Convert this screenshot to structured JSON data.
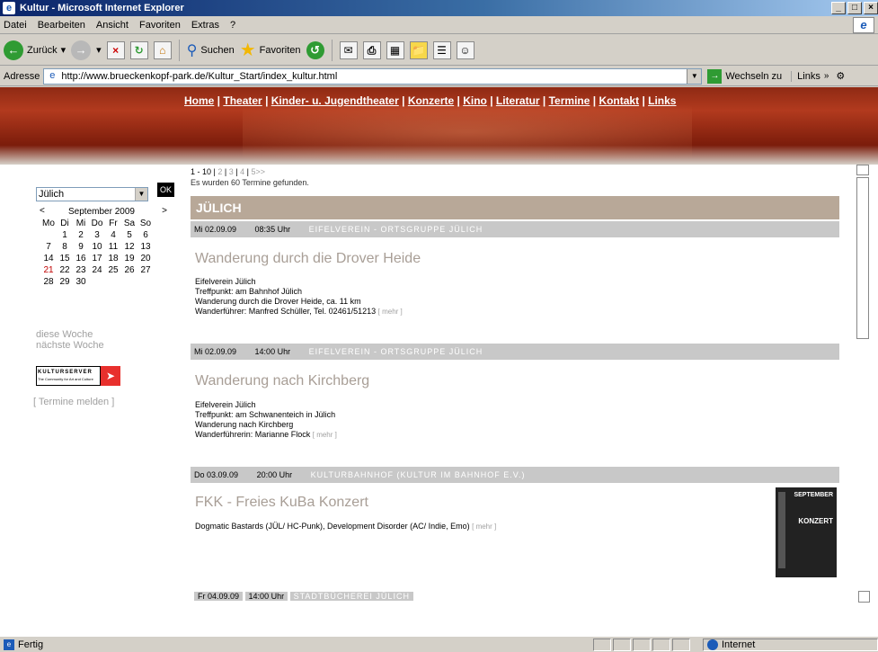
{
  "window": {
    "title": "Kultur - Microsoft Internet Explorer",
    "buttons": [
      "_",
      "□",
      "×"
    ]
  },
  "menu": [
    "Datei",
    "Bearbeiten",
    "Ansicht",
    "Favoriten",
    "Extras",
    "?"
  ],
  "toolbar": {
    "back": "Zurück",
    "search": "Suchen",
    "favorites": "Favoriten"
  },
  "address": {
    "label": "Adresse",
    "url": "http://www.brueckenkopf-park.de/Kultur_Start/index_kultur.html",
    "go": "Wechseln zu",
    "links": "Links"
  },
  "nav": {
    "items": [
      "Home",
      "Theater",
      "Kinder- u. Jugendtheater",
      "Konzerte",
      "Kino",
      "Literatur",
      "Termine",
      "Kontakt",
      "Links"
    ]
  },
  "sidebar": {
    "location": "Jülich",
    "ok": "OK",
    "calendar": {
      "month": "September 2009",
      "prev": "<",
      "next": ">",
      "weekdays": [
        "Mo",
        "Di",
        "Mi",
        "Do",
        "Fr",
        "Sa",
        "So"
      ],
      "days": [
        "",
        "1",
        "2",
        "3",
        "4",
        "5",
        "6",
        "7",
        "8",
        "9",
        "10",
        "11",
        "12",
        "13",
        "14",
        "15",
        "16",
        "17",
        "18",
        "19",
        "20",
        "21",
        "22",
        "23",
        "24",
        "25",
        "26",
        "27",
        "28",
        "29",
        "30"
      ],
      "highlight_day": "21"
    },
    "this_week": "diese Woche",
    "next_week": "nächste Woche",
    "banner_title": "KULTURSERVER",
    "banner_sub": "The Community for Art and Culture",
    "report_link": "[ Termine melden ]"
  },
  "content": {
    "pager_current": "1 - 10",
    "pager_pages": [
      "2",
      "3",
      "4",
      "5>>"
    ],
    "found": "Es wurden 60 Termine gefunden.",
    "city": "JÜLICH",
    "events": [
      {
        "date": "Mi 02.09.09",
        "time": "08:35 Uhr",
        "org": "EIFELVEREIN - ORTSGRUPPE JÜLICH",
        "title": "Wanderung durch die Drover Heide",
        "lines": [
          "Eifelverein Jülich",
          "Treffpunkt: am Bahnhof Jülich",
          "Wanderung durch die Drover Heide, ca. 11 km",
          "Wanderführer: Manfred Schüller, Tel. 02461/51213"
        ],
        "more": "[ mehr ]"
      },
      {
        "date": "Mi 02.09.09",
        "time": "14:00 Uhr",
        "org": "EIFELVEREIN - ORTSGRUPPE JÜLICH",
        "title": "Wanderung nach Kirchberg",
        "lines": [
          "Eifelverein Jülich",
          "Treffpunkt: am Schwanenteich in Jülich",
          "Wanderung nach Kirchberg",
          "Wanderführerin: Marianne Flock"
        ],
        "more": "[ mehr ]"
      },
      {
        "date": "Do 03.09.09",
        "time": "20:00 Uhr",
        "org": "KULTURBAHNHOF (KULTUR IM BAHNHOF E.V.)",
        "title": "FKK - Freies KuBa Konzert",
        "lines": [
          "Dogmatic Bastards (JÜL/ HC-Punk), Development Disorder (AC/ Indie, Emo)"
        ],
        "more": "[ mehr ]",
        "poster": [
          "SEPTEMBER",
          "KONZERT"
        ]
      },
      {
        "date": "Fr 04.09.09",
        "time": "14:00 Uhr",
        "org": "STADTBÜCHEREI JÜLICH"
      }
    ]
  },
  "status": {
    "left": "Fertig",
    "zone": "Internet"
  }
}
